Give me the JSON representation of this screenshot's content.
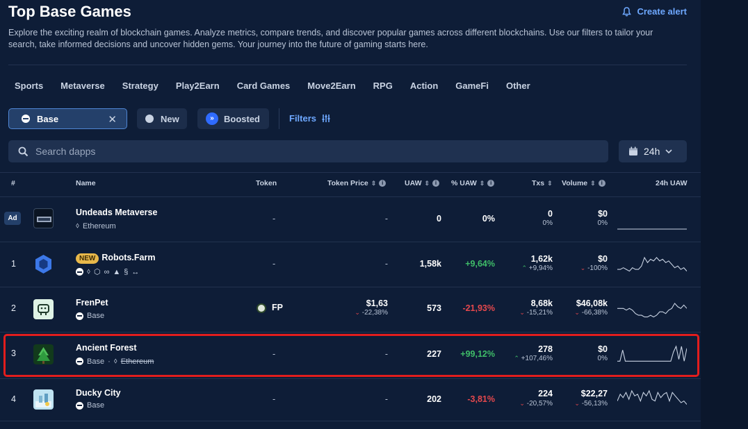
{
  "header": {
    "title": "Top Base Games",
    "create_alert": "Create alert",
    "description": "Explore the exciting realm of blockchain games. Analyze metrics, compare trends, and discover popular games across different blockchains. Use our filters to tailor your search, take informed decisions and uncover hidden gems. Your journey into the future of gaming starts here."
  },
  "categories": [
    "Sports",
    "Metaverse",
    "Strategy",
    "Play2Earn",
    "Card Games",
    "Move2Earn",
    "RPG",
    "Action",
    "GameFi",
    "Other"
  ],
  "filters": {
    "chain": "Base",
    "new": "New",
    "boosted": "Boosted",
    "filters_label": "Filters"
  },
  "search": {
    "placeholder": "Search dapps"
  },
  "period": {
    "selected": "24h"
  },
  "columns": {
    "rank": "#",
    "name": "Name",
    "token": "Token",
    "token_price": "Token Price",
    "uaw": "UAW",
    "pct_uaw": "% UAW",
    "txs": "Txs",
    "volume": "Volume",
    "uaw_24h": "24h UAW"
  },
  "rows": [
    {
      "rank": "",
      "ad": "Ad",
      "name": "Undeads Metaverse",
      "chains": [
        "Ethereum"
      ],
      "token": "-",
      "token_price": "-",
      "uaw": "0",
      "pct_uaw": "0%",
      "txs": "0",
      "txs_change": "0%",
      "volume": "$0",
      "volume_change": "0%",
      "sparkline": [
        0,
        0,
        0,
        0,
        0,
        0,
        0,
        0,
        0,
        0,
        0,
        0,
        0,
        0,
        0,
        0,
        0,
        0,
        0,
        0
      ]
    },
    {
      "rank": "1",
      "badge": "NEW",
      "name": "Robots.Farm",
      "chains": [
        "Base",
        "Ethereum",
        "+more"
      ],
      "token": "-",
      "token_price": "-",
      "uaw": "1,58k",
      "pct_uaw": "+9,64%",
      "txs": "1,62k",
      "txs_change": "+9,94%",
      "volume": "$0",
      "volume_change": "-100%",
      "sparkline": [
        2,
        2,
        3,
        2,
        1,
        3,
        2,
        2,
        4,
        9,
        6,
        8,
        7,
        9,
        7,
        8,
        6,
        7,
        5,
        3,
        4,
        2,
        3,
        1
      ]
    },
    {
      "rank": "2",
      "name": "FrenPet",
      "chains": [
        "Base"
      ],
      "token": "FP",
      "token_price": "$1,63",
      "token_price_change": "-22,38%",
      "uaw": "573",
      "pct_uaw": "-21,93%",
      "txs": "8,68k",
      "txs_change": "-15,21%",
      "volume": "$46,08k",
      "volume_change": "-66,38%",
      "sparkline": [
        6,
        6,
        6,
        5,
        6,
        5,
        3,
        2,
        2,
        1,
        1,
        2,
        1,
        2,
        4,
        4,
        3,
        5,
        6,
        9,
        7,
        6,
        8,
        6
      ]
    },
    {
      "rank": "3",
      "name": "Ancient Forest",
      "chains": [
        "Base",
        "Ethereum"
      ],
      "token": "-",
      "token_price": "-",
      "uaw": "227",
      "pct_uaw": "+99,12%",
      "txs": "278",
      "txs_change": "+107,46%",
      "volume": "$0",
      "volume_change": "0%",
      "sparkline": [
        1,
        1,
        7,
        1,
        1,
        1,
        1,
        1,
        1,
        1,
        1,
        1,
        1,
        1,
        1,
        1,
        1,
        1,
        1,
        1,
        1,
        6,
        9,
        2,
        9,
        1,
        8
      ]
    },
    {
      "rank": "4",
      "name": "Ducky City",
      "chains": [
        "Base"
      ],
      "token": "-",
      "token_price": "-",
      "uaw": "202",
      "pct_uaw": "-3,81%",
      "txs": "224",
      "txs_change": "-20,57%",
      "volume": "$22,27",
      "volume_change": "-56,13%",
      "sparkline": [
        3,
        7,
        5,
        8,
        4,
        9,
        6,
        7,
        3,
        8,
        6,
        9,
        4,
        3,
        8,
        5,
        7,
        8,
        3,
        8,
        6,
        4,
        2,
        3,
        1
      ]
    }
  ],
  "colors": {
    "background": "#0e1d37",
    "accent": "#6ea8ff",
    "positive": "#3fbd68",
    "negative": "#e5484d",
    "highlight_border": "#e21d1d"
  }
}
